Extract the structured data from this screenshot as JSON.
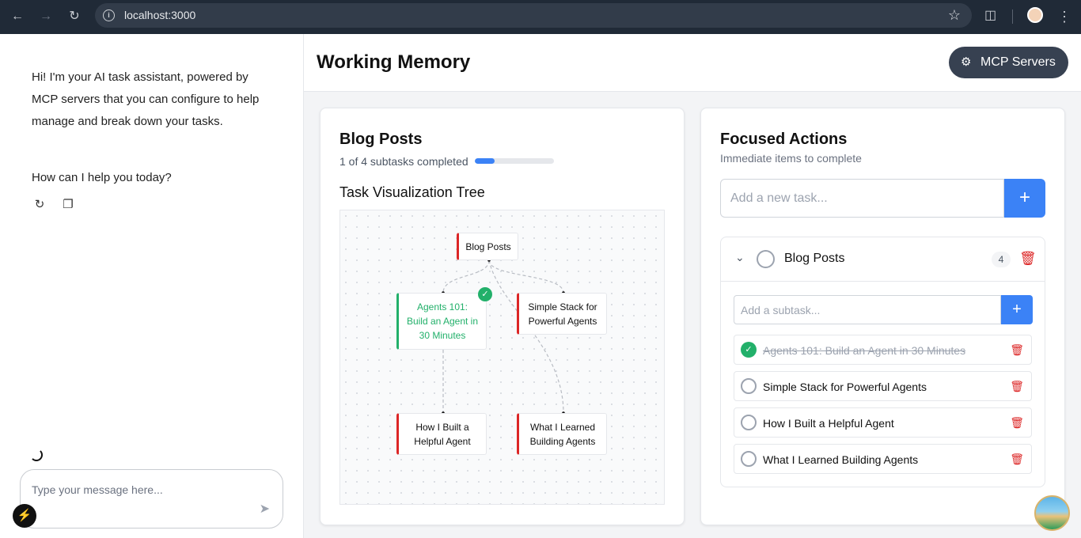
{
  "browser": {
    "url": "localhost:3000"
  },
  "chat": {
    "greeting": "Hi! I'm your AI task assistant, powered by MCP servers that you can configure to help manage and break down your tasks.",
    "question": "How can I help you today?",
    "input_placeholder": "Type your message here..."
  },
  "header": {
    "title": "Working Memory",
    "mcp_button": "MCP Servers"
  },
  "project": {
    "title": "Blog Posts",
    "progress_text": "1 of 4 subtasks completed",
    "progress_fraction": 0.25,
    "viz_title": "Task Visualization Tree",
    "tree": {
      "root": "Blog Posts",
      "nodes": [
        {
          "label": "Agents 101: Build an Agent in 30 Minutes",
          "done": true
        },
        {
          "label": "Simple Stack for Powerful Agents",
          "done": false
        },
        {
          "label": "How I Built a Helpful Agent",
          "done": false
        },
        {
          "label": "What I Learned Building Agents",
          "done": false
        }
      ]
    }
  },
  "focused": {
    "title": "Focused Actions",
    "subtitle": "Immediate items to complete",
    "task_placeholder": "Add a new task...",
    "group": {
      "title": "Blog Posts",
      "count": "4",
      "subtask_placeholder": "Add a subtask...",
      "subtasks": [
        {
          "label": "Agents 101: Build an Agent in 30 Minutes",
          "done": true
        },
        {
          "label": "Simple Stack for Powerful Agents",
          "done": false
        },
        {
          "label": "How I Built a Helpful Agent",
          "done": false
        },
        {
          "label": "What I Learned Building Agents",
          "done": false
        }
      ]
    }
  },
  "colors": {
    "accent": "#3b82f6",
    "done": "#22b06a",
    "pending": "#dc2626",
    "dark_button": "#374151"
  }
}
